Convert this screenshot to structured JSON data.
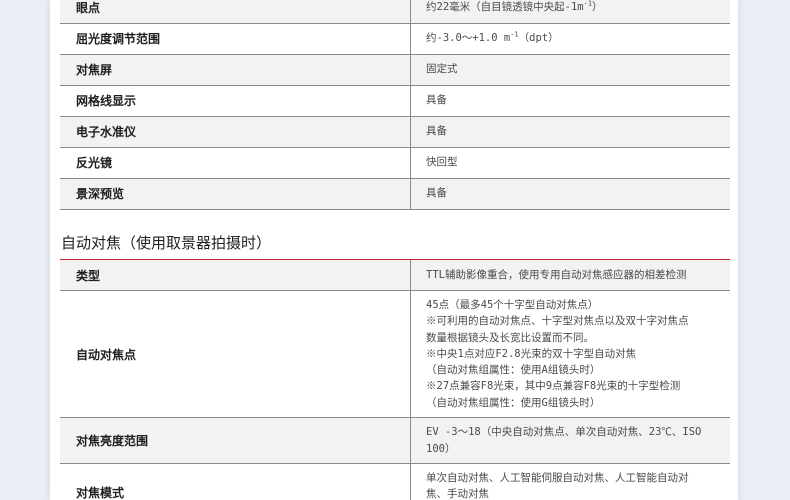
{
  "table1": [
    {
      "label": "眼点",
      "value_main": "约22毫米（自目镜透镜中央起-1m",
      "value_sup": "-1",
      "value_tail": "）"
    },
    {
      "label": "屈光度调节范围",
      "value_main": "约-3.0～+1.0 m",
      "value_sup": "-1",
      "value_tail": "（dpt）"
    },
    {
      "label": "对焦屏",
      "value": "固定式"
    },
    {
      "label": "网格线显示",
      "value": "具备"
    },
    {
      "label": "电子水准仪",
      "value": "具备"
    },
    {
      "label": "反光镜",
      "value": "快回型"
    },
    {
      "label": "景深预览",
      "value": "具备"
    }
  ],
  "section_title": "自动对焦（使用取景器拍摄时）",
  "table2": {
    "type": {
      "label": "类型",
      "value": "TTL辅助影像重合，使用专用自动对焦感应器的相差检测"
    },
    "af_points": {
      "label": "自动对焦点",
      "lines": [
        "45点（最多45个十字型自动对焦点）",
        "※可利用的自动对焦点、十字型对焦点以及双十字对焦点",
        "数量根据镜头及长宽比设置而不同。",
        "※中央1点对应F2.8光束的双十字型自动对焦",
        "（自动对焦组属性：使用A组镜头时）",
        "※27点兼容F8光束，其中9点兼容F8光束的十字型检测",
        "（自动对焦组属性：使用G组镜头时）"
      ]
    },
    "brightness_range": {
      "label": "对焦亮度范围",
      "lines": [
        "EV -3～18（中央自动对焦点、单次自动对焦、23℃、ISO",
        "100）"
      ]
    },
    "focus_mode": {
      "label": "对焦模式",
      "lines": [
        "单次自动对焦、人工智能伺服自动对焦、人工智能自动对",
        "焦、手动对焦"
      ]
    }
  },
  "colors": {
    "accent_rule": "#c1272d",
    "row_shade": "#f2f2f2",
    "background": "#e9eef7"
  }
}
